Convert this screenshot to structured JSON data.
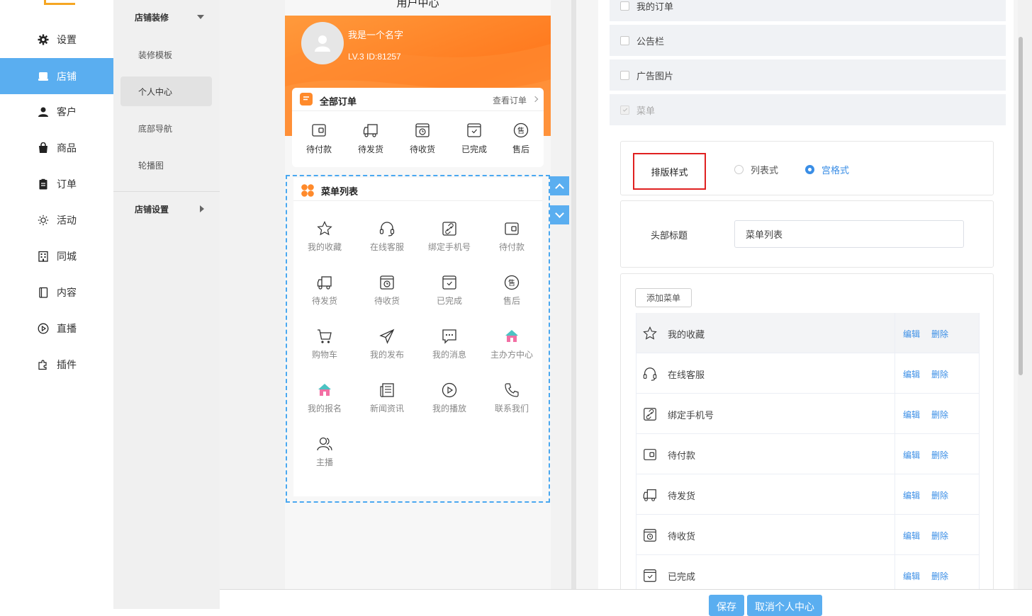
{
  "nav": {
    "items": [
      {
        "label": "设置",
        "icon": "gear-icon"
      },
      {
        "label": "店铺",
        "icon": "shop-icon"
      },
      {
        "label": "客户",
        "icon": "user-icon"
      },
      {
        "label": "商品",
        "icon": "bag-icon"
      },
      {
        "label": "订单",
        "icon": "clipboard-icon"
      },
      {
        "label": "活动",
        "icon": "sun-icon"
      },
      {
        "label": "同城",
        "icon": "building-icon"
      },
      {
        "label": "内容",
        "icon": "book-icon"
      },
      {
        "label": "直播",
        "icon": "play-circle-icon"
      },
      {
        "label": "插件",
        "icon": "puzzle-icon"
      }
    ],
    "active": "店铺",
    "accent": "#5aaef0"
  },
  "subnav": {
    "group1": "店铺装修",
    "items": [
      "装修模板",
      "个人中心",
      "底部导航",
      "轮播图"
    ],
    "active": "个人中心",
    "group2": "店铺设置"
  },
  "phone": {
    "title": "用户中心",
    "username": "我是一个名字",
    "level_id": "LV.3   ID:81257",
    "orders": {
      "title": "全部订单",
      "more": "查看订单",
      "items": [
        "待付款",
        "待发货",
        "待收货",
        "已完成",
        "售后"
      ]
    },
    "menu": {
      "title": "菜单列表",
      "items": [
        "我的收藏",
        "在线客服",
        "绑定手机号",
        "待付款",
        "待发货",
        "待收货",
        "已完成",
        "售后",
        "购物车",
        "我的发布",
        "我的消息",
        "主办方中心",
        "我的报名",
        "新闻资讯",
        "我的播放",
        "联系我们",
        "主播"
      ]
    }
  },
  "panel": {
    "components": [
      "我的订单",
      "公告栏",
      "广告图片",
      "菜单"
    ],
    "layout_label": "排版样式",
    "layout_options": [
      "列表式",
      "宫格式"
    ],
    "layout_selected": "宫格式",
    "header_title_label": "头部标题",
    "header_title_value": "菜单列表",
    "add_button": "添加菜单",
    "edit_label": "编辑",
    "delete_label": "删除",
    "rows": [
      "我的收藏",
      "在线客服",
      "绑定手机号",
      "待付款",
      "待发货",
      "待收货",
      "已完成"
    ]
  },
  "footer": {
    "save": "保存",
    "cancel": "取消个人中心"
  }
}
